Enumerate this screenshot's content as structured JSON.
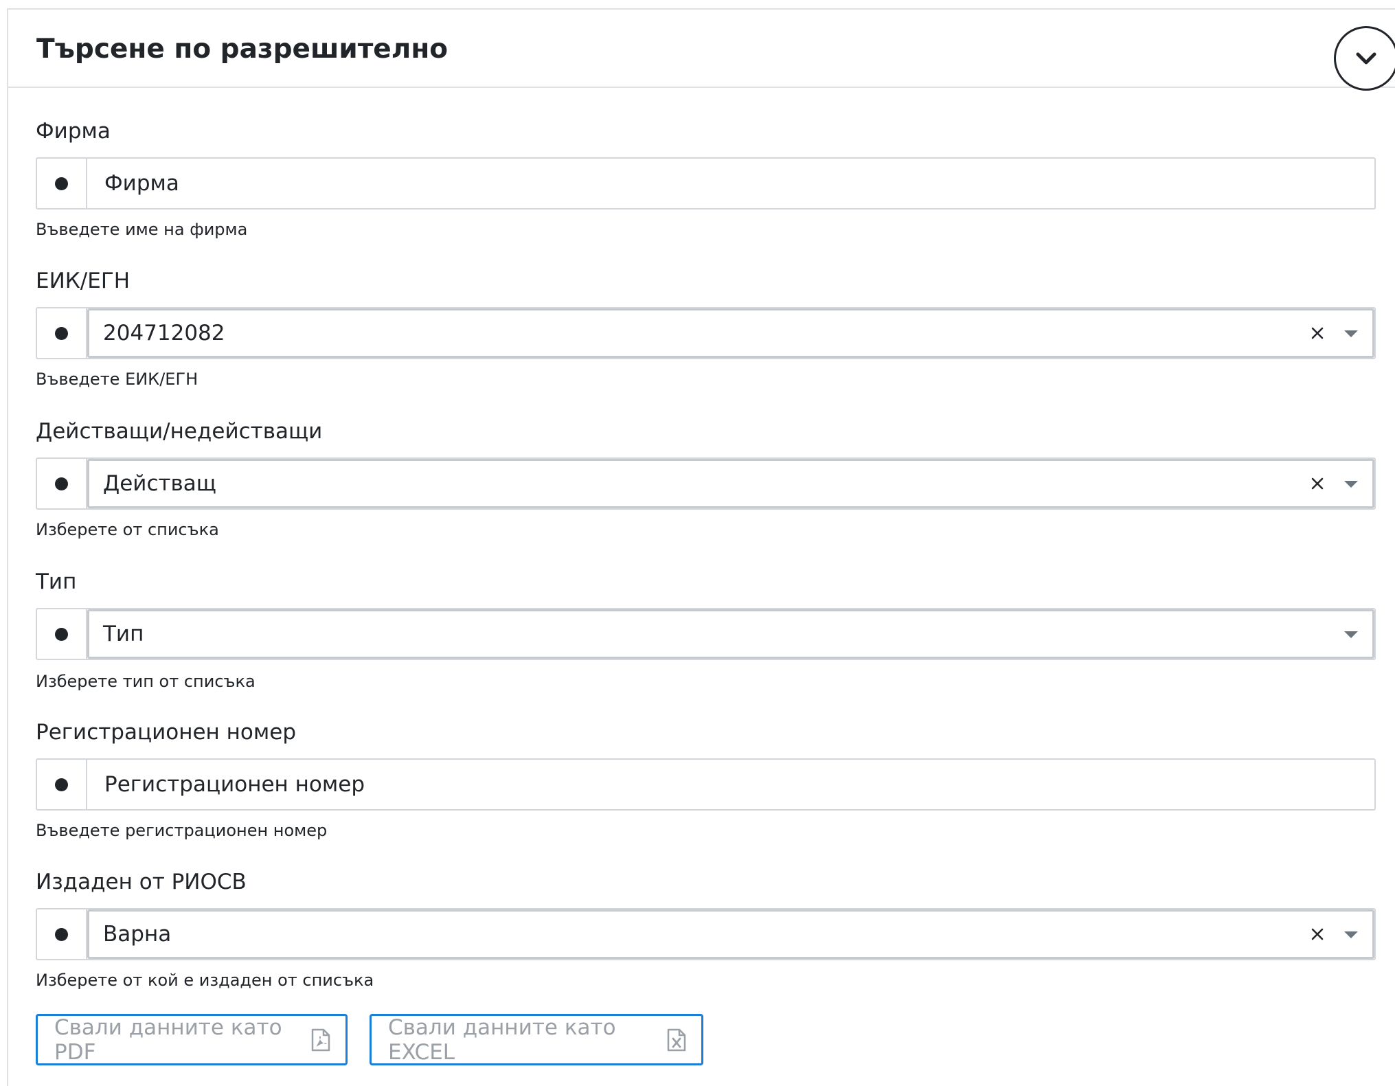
{
  "header": {
    "title": "Търсене по разрешително"
  },
  "fields": [
    {
      "label": "Фирма",
      "type": "text",
      "placeholder": "Фирма",
      "value": "",
      "help": "Въведете име на фирма"
    },
    {
      "label": "ЕИК/ЕГН",
      "type": "select",
      "value": "204712082",
      "clearable": true,
      "help": "Въведете ЕИК/ЕГН"
    },
    {
      "label": "Действащи/недействащи",
      "type": "select",
      "value": "Действащ",
      "clearable": true,
      "help": "Изберете от списъка"
    },
    {
      "label": "Тип",
      "type": "select",
      "value": "Тип",
      "clearable": false,
      "help": "Изберете тип от списъка"
    },
    {
      "label": "Регистрационен номер",
      "type": "text",
      "placeholder": "Регистрационен номер",
      "value": "",
      "help": "Въведете регистрационен номер"
    },
    {
      "label": "Издаден от РИОСВ",
      "type": "select",
      "value": "Варна",
      "clearable": true,
      "help": "Изберете от кой е издаден от списъка"
    }
  ],
  "actions": {
    "pdf_label": "Свали данните като PDF",
    "excel_label": "Свали данните като EXCEL"
  },
  "icons": {
    "collapse": "chevron-down-icon",
    "addon": "dot-icon",
    "clear": "close-icon",
    "dropdown": "caret-down-icon",
    "pdf": "pdf-file-icon",
    "excel": "excel-file-icon"
  },
  "colors": {
    "button_border": "#1b7fd8",
    "button_text": "#9aa0a6",
    "border": "#d3d6da",
    "text": "#212529"
  }
}
